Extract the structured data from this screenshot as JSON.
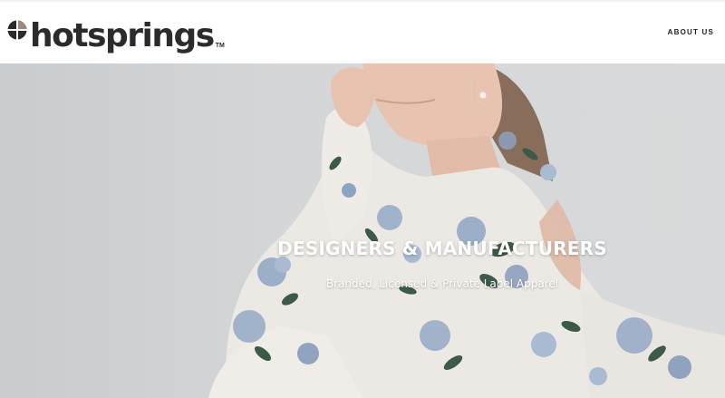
{
  "header": {
    "logo_text": "hotsprings",
    "logo_tm": "TM",
    "nav": [
      {
        "label": "ABOUT US"
      }
    ]
  },
  "hero": {
    "title": "DESIGNERS & MANUFACTURERS",
    "subtitle": "Branded, Licensed & Private Label Apparel"
  },
  "colors": {
    "logo_dark": "#2b2b2b",
    "header_bg": "#ffffff",
    "hero_bg": "#d2d4d6",
    "dress": "#ece9e4",
    "floral_blue": "#8ea4c4",
    "floral_green": "#3d5a48",
    "hair": "#7a5a44",
    "skin": "#e8c4b0"
  },
  "icons": [
    "hotsprings-logo-mark"
  ]
}
